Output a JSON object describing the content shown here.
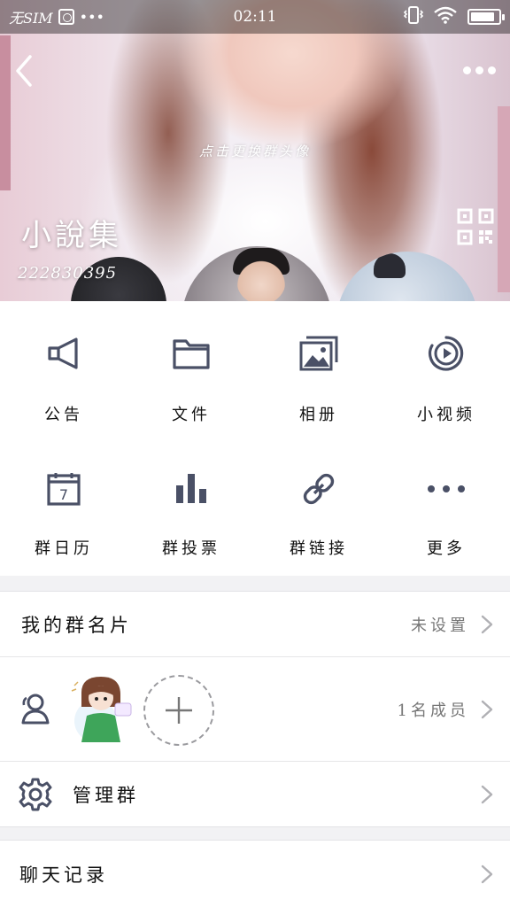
{
  "status_bar": {
    "carrier": "无SIM",
    "dots": "•••",
    "time": "02:11",
    "battery_level": 0.85
  },
  "header": {
    "change_avatar_hint": "点击更换群头像",
    "group_name": "小說集",
    "group_id": "222830395"
  },
  "actions": [
    {
      "label": "公告",
      "icon": "megaphone-icon"
    },
    {
      "label": "文件",
      "icon": "folder-icon"
    },
    {
      "label": "相册",
      "icon": "photo-album-icon"
    },
    {
      "label": "小视频",
      "icon": "video-icon"
    },
    {
      "label": "群日历",
      "icon": "calendar-icon",
      "day": "7"
    },
    {
      "label": "群投票",
      "icon": "bar-chart-icon"
    },
    {
      "label": "群链接",
      "icon": "link-icon"
    },
    {
      "label": "更多",
      "icon": "more-dots-icon"
    }
  ],
  "my_card": {
    "label": "我的群名片",
    "value": "未设置"
  },
  "members": {
    "count_label": "1名成员"
  },
  "manage": {
    "label": "管理群"
  },
  "chat_history": {
    "label": "聊天记录"
  },
  "colors": {
    "icon": "#4a5066",
    "background": "#f2f2f4",
    "chevron": "#b0b0b4"
  }
}
